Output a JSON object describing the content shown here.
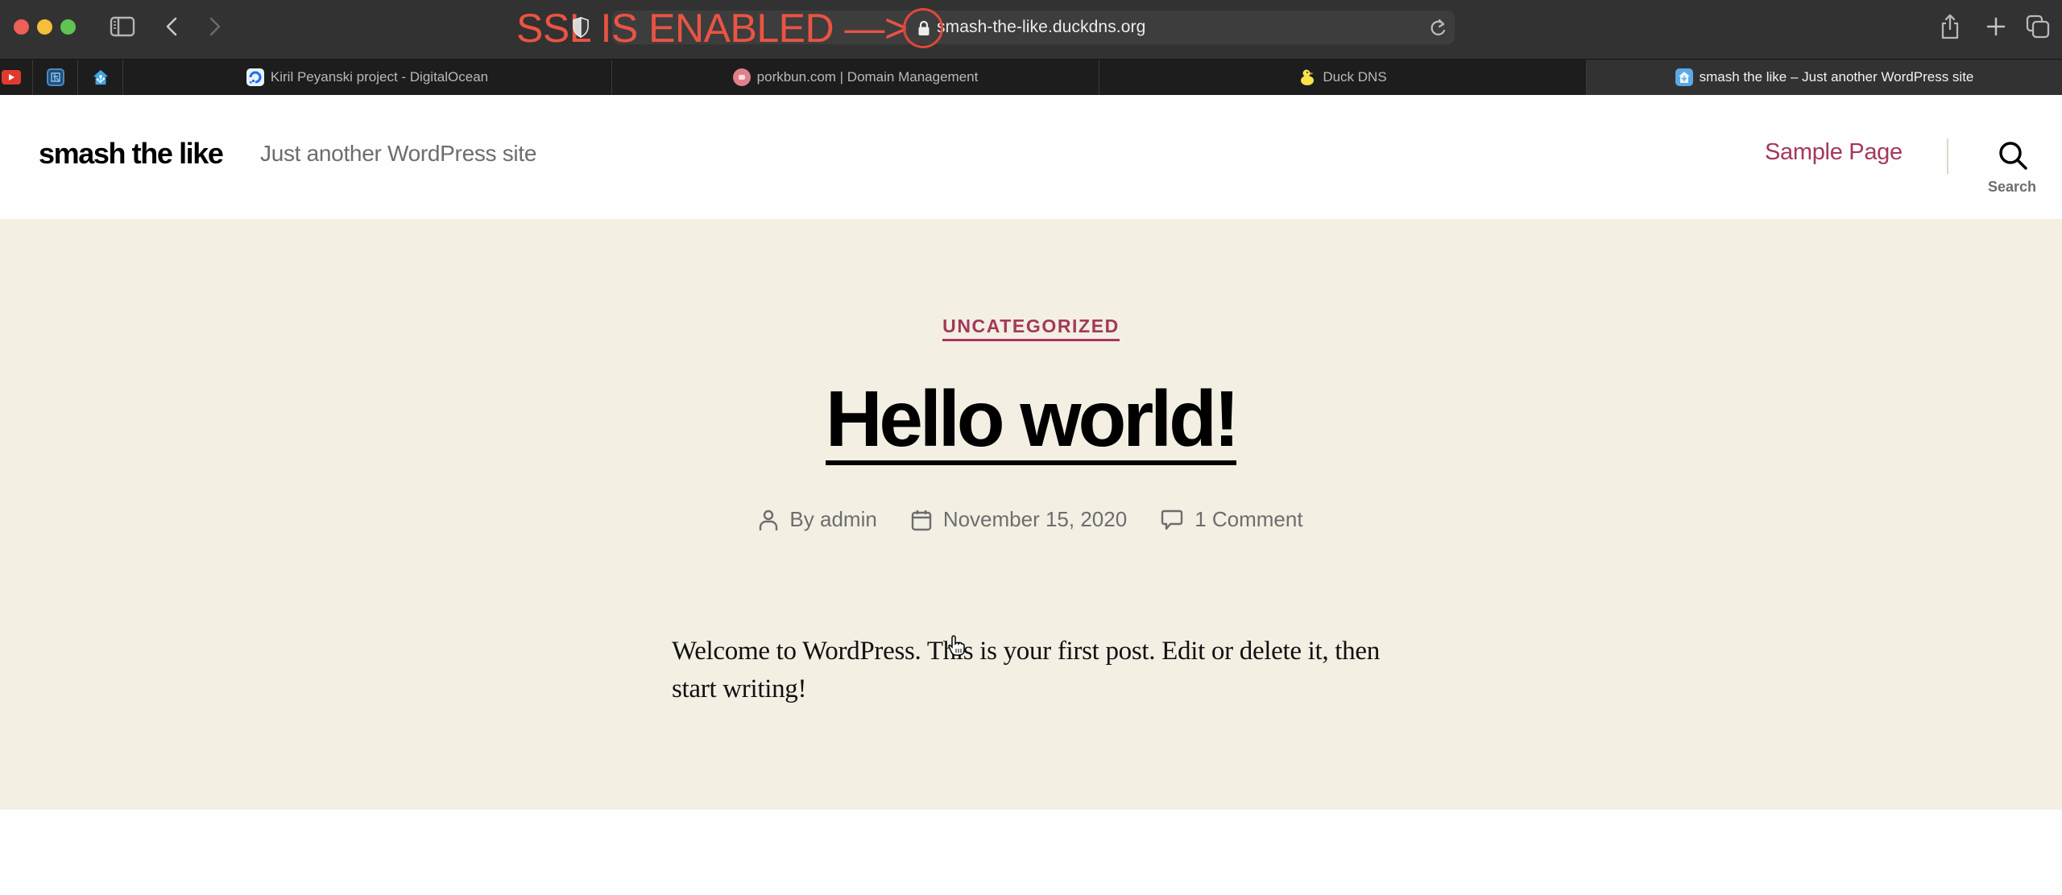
{
  "browser": {
    "annotation": "SSL IS ENABLED —>",
    "url": "smash-the-like.duckdns.org",
    "icons": {
      "sidebar": "sidebar-icon",
      "back": "chevron-left-icon",
      "forward": "chevron-right-icon",
      "shield": "shield-icon",
      "lock": "lock-icon",
      "reload": "reload-icon",
      "share": "share-icon",
      "new_tab": "plus-icon",
      "tab_overview": "tabs-icon"
    },
    "pinned_tabs": [
      {
        "icon": "youtube-icon",
        "color": "#e03a2c"
      },
      {
        "icon": "app-icon",
        "color": "#2e6da4"
      },
      {
        "icon": "home-assistant-icon",
        "color": "#41a5e6"
      }
    ],
    "tabs": [
      {
        "title": "Kiril Peyanski project - DigitalOcean",
        "icon": "digitalocean-icon",
        "active": false
      },
      {
        "title": "porkbun.com | Domain Management",
        "icon": "porkbun-icon",
        "active": false
      },
      {
        "title": "Duck DNS",
        "icon": "duck-icon",
        "active": false
      },
      {
        "title": "smash the like – Just another WordPress site",
        "icon": "wordpress-site-icon",
        "active": true
      }
    ]
  },
  "site": {
    "title": "smash the like",
    "description": "Just another WordPress site",
    "nav": [
      {
        "label": "Sample Page"
      }
    ],
    "search_label": "Search",
    "accent_color": "#a4385a",
    "background_color": "#f3efe3"
  },
  "post": {
    "category": "UNCATEGORIZED",
    "title": "Hello world!",
    "author": "By admin",
    "date": "November 15, 2020",
    "comments": "1 Comment",
    "body": "Welcome to WordPress. This is your first post. Edit or delete it, then start writing!"
  }
}
